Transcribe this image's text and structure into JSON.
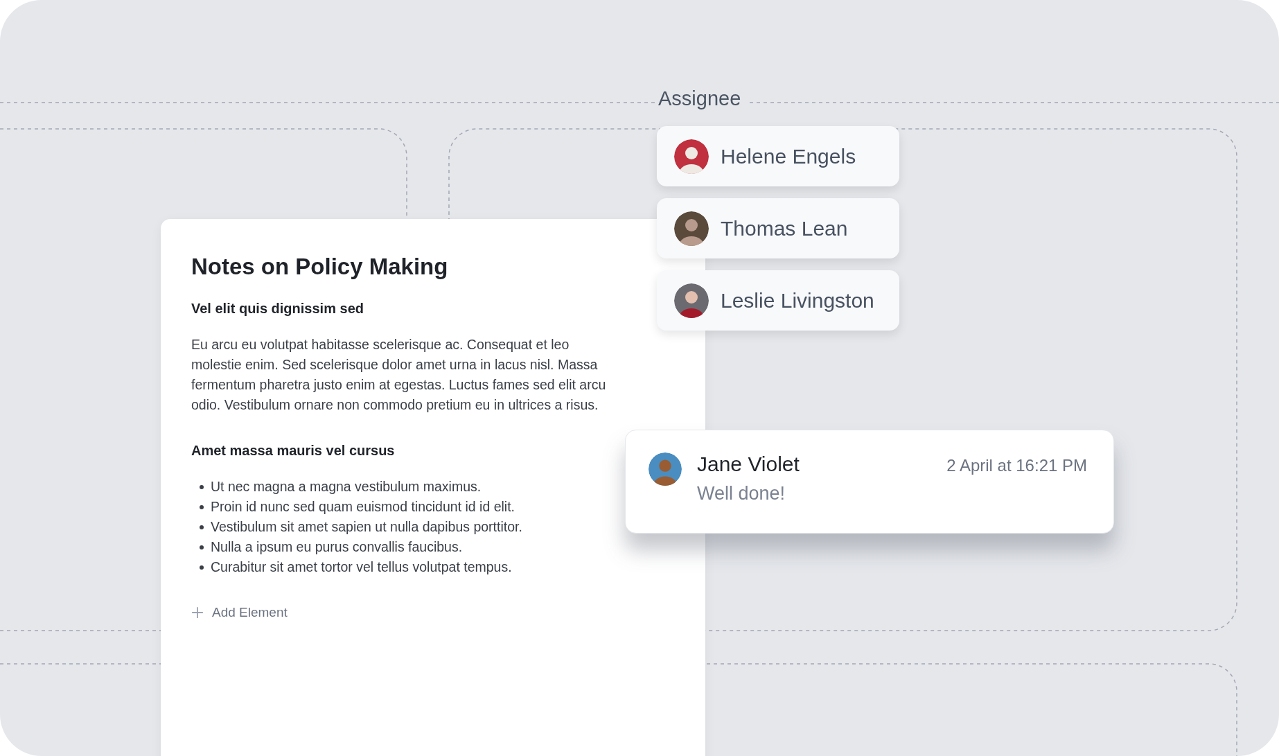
{
  "assignee_panel": {
    "label": "Assignee",
    "people": [
      {
        "name": "Helene Engels"
      },
      {
        "name": "Thomas Lean"
      },
      {
        "name": "Leslie Livingston"
      }
    ]
  },
  "document": {
    "title": "Notes on Policy Making",
    "sections": [
      {
        "kind": "paragraph",
        "heading": "Vel elit quis dignissim sed",
        "text": "Eu arcu eu volutpat habitasse scelerisque ac. Consequat et leo molestie enim. Sed scelerisque dolor amet urna in lacus nisl. Massa fermentum pharetra justo enim at egestas. Luctus fames sed elit arcu odio. Vestibulum ornare non commodo pretium eu in ultrices a risus."
      },
      {
        "kind": "bullets",
        "heading": "Amet massa mauris vel cursus",
        "items": [
          "Ut nec magna a magna vestibulum maximus.",
          "Proin id nunc sed quam euismod tincidunt id id elit.",
          "Vestibulum sit amet sapien ut nulla dapibus porttitor.",
          "Nulla a ipsum eu purus convallis faucibus.",
          "Curabitur sit amet tortor vel tellus volutpat tempus."
        ]
      }
    ],
    "add_button": "Add Element"
  },
  "comment": {
    "author": "Jane Violet",
    "time": "2 April at 16:21 PM",
    "text": "Well done!"
  }
}
